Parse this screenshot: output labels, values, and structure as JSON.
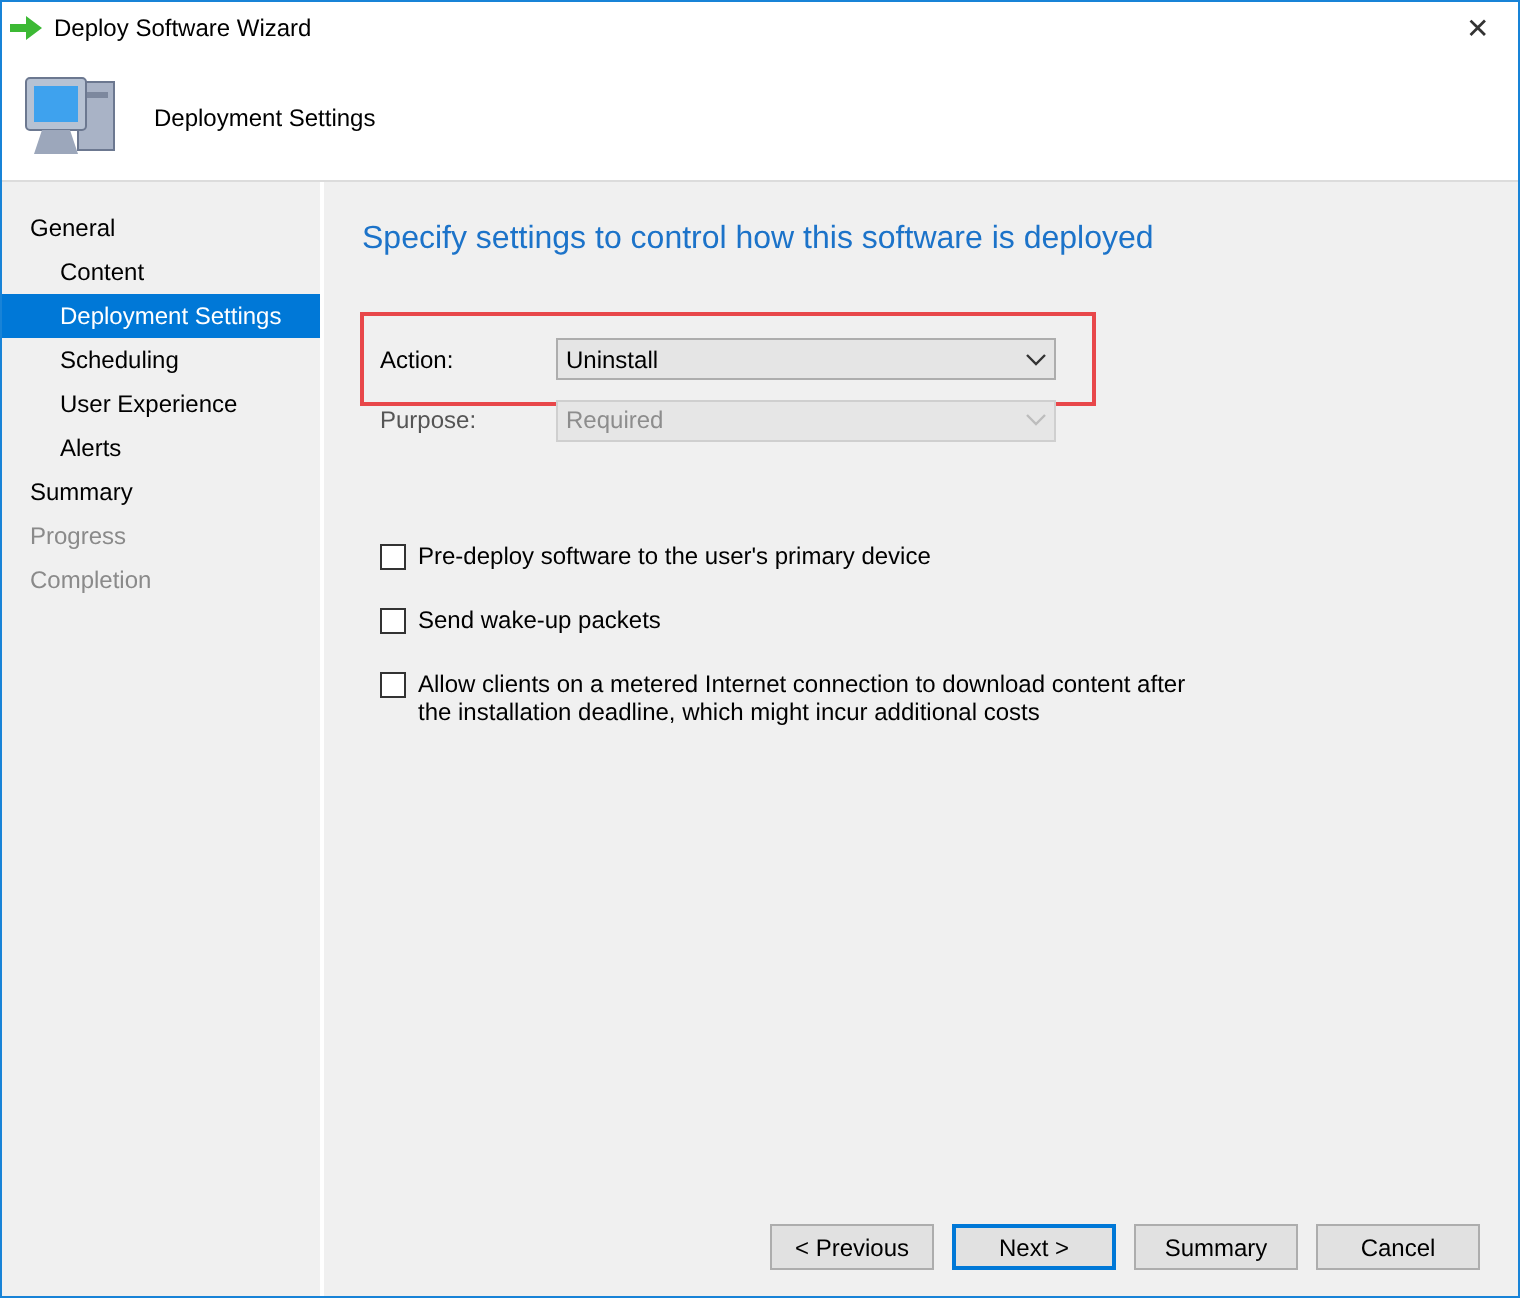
{
  "window": {
    "title": "Deploy Software Wizard",
    "close": "✕"
  },
  "header": {
    "title": "Deployment Settings"
  },
  "sidebar": {
    "items": [
      {
        "label": "General",
        "selected": false,
        "disabled": false,
        "children": [
          {
            "label": "Content",
            "selected": false,
            "disabled": false
          },
          {
            "label": "Deployment Settings",
            "selected": true,
            "disabled": false
          },
          {
            "label": "Scheduling",
            "selected": false,
            "disabled": false
          },
          {
            "label": "User Experience",
            "selected": false,
            "disabled": false
          },
          {
            "label": "Alerts",
            "selected": false,
            "disabled": false
          }
        ]
      },
      {
        "label": "Summary",
        "selected": false,
        "disabled": false
      },
      {
        "label": "Progress",
        "selected": false,
        "disabled": true
      },
      {
        "label": "Completion",
        "selected": false,
        "disabled": true
      }
    ]
  },
  "page": {
    "heading": "Specify settings to control how this software is deployed",
    "fields": [
      {
        "label": "Action:",
        "value": "Uninstall",
        "disabled": false,
        "highlighted": true
      },
      {
        "label": "Purpose:",
        "value": "Required",
        "disabled": true,
        "highlighted": false
      }
    ],
    "options": [
      {
        "label": "Pre-deploy software to the user's primary device",
        "checked": false
      },
      {
        "label": "Send wake-up packets",
        "checked": false
      },
      {
        "label": "Allow clients on a metered Internet connection to download content after the installation deadline, which might incur additional costs",
        "checked": false
      }
    ]
  },
  "buttons": [
    {
      "label": "< Previous",
      "default": false
    },
    {
      "label": "Next >",
      "default": true
    },
    {
      "label": "Summary",
      "default": false
    },
    {
      "label": "Cancel",
      "default": false
    }
  ]
}
